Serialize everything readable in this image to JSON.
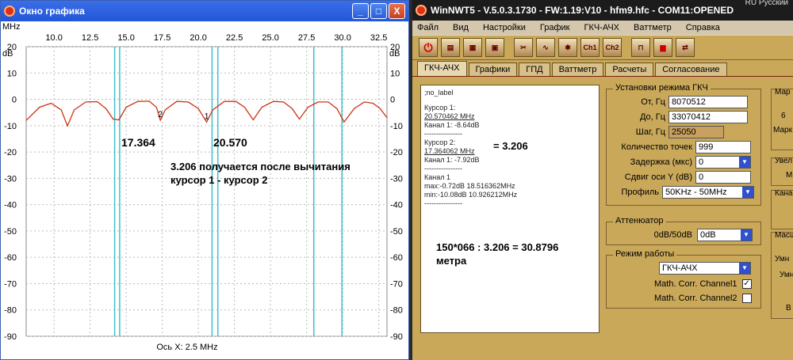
{
  "graph_window": {
    "title": "Окно графика",
    "buttons": {
      "minimize": "_",
      "maximize": "□",
      "close": "X"
    },
    "axis": {
      "mhz_label": "MHz",
      "db_label": "dB",
      "x_ticks": [
        "10.0",
        "12.5",
        "15.0",
        "17.5",
        "20.0",
        "22.5",
        "25.0",
        "27.5",
        "30.0",
        "32.5"
      ],
      "y_ticks": [
        "20",
        "10",
        "0",
        "-10",
        "-20",
        "-30",
        "-40",
        "-50",
        "-60",
        "-70",
        "-80",
        "-90"
      ],
      "x_caption": "Ось X: 2.5 MHz"
    },
    "markers": {
      "cursor1": "1",
      "cursor2": "2"
    },
    "annotations": {
      "cursor2_value": "17.364",
      "cursor1_value": "20.570",
      "note_line1": "3.206 получается после вычитания",
      "note_line2": "курсор 1 - курсор 2"
    },
    "trace_color": "#d03010"
  },
  "chart_data": {
    "type": "line",
    "title": "",
    "xlabel": "Ось X: 2.5 MHz",
    "ylabel": "dB",
    "xlim": [
      8.07,
      33.07
    ],
    "ylim": [
      -90,
      20
    ],
    "x_ticks": [
      10.0,
      12.5,
      15.0,
      17.5,
      20.0,
      22.5,
      25.0,
      27.5,
      30.0,
      32.5
    ],
    "y_ticks": [
      20,
      10,
      0,
      -10,
      -20,
      -30,
      -40,
      -50,
      -60,
      -70,
      -80,
      -90
    ],
    "grid": true,
    "series": [
      {
        "name": "Канал 1",
        "color": "#d03010",
        "x": [
          8.07,
          9.0,
          9.8,
          10.5,
          10.93,
          11.4,
          12.2,
          13.0,
          13.6,
          14.1,
          14.5,
          15.0,
          15.8,
          16.6,
          17.1,
          17.364,
          17.7,
          18.5,
          19.3,
          20.0,
          20.57,
          21.0,
          21.8,
          22.6,
          23.2,
          23.8,
          24.4,
          25.2,
          25.9,
          26.5,
          27.0,
          27.6,
          28.3,
          29.0,
          29.6,
          30.1,
          30.8,
          31.5,
          32.1,
          32.6,
          33.07
        ],
        "y": [
          -8,
          -3,
          -1.5,
          -4,
          -10.1,
          -4,
          -1,
          -0.9,
          -3.5,
          -7.5,
          -7.8,
          -3,
          -0.8,
          -0.72,
          -3,
          -7.92,
          -4,
          -0.8,
          -1,
          -3.5,
          -8.64,
          -4,
          -0.8,
          -0.8,
          -3,
          -7.8,
          -3,
          -0.8,
          -1,
          -3.5,
          -7.5,
          -3,
          -1,
          -1,
          -3.5,
          -8.6,
          -3.5,
          -1,
          -1.5,
          -3.5,
          -7
        ]
      }
    ],
    "cursors": [
      {
        "label": "1",
        "x": 20.570462,
        "y": -8.64
      },
      {
        "label": "2",
        "x": 17.364062,
        "y": -7.92
      }
    ],
    "vertical_markers_x": [
      14.2,
      14.55,
      20.95,
      21.35,
      28.0,
      29.95
    ]
  },
  "nwt_window": {
    "title": "WinNWT5 - V.5.0.3.1730 - FW:1.19:V10 - hfm9.hfc - COM11:OPENED",
    "status": "RU Русский",
    "menu": [
      "Файл",
      "Вид",
      "Настройки",
      "График",
      "ГКЧ-АЧХ",
      "Ваттметр",
      "Справка"
    ],
    "toolbar": [
      "power-icon",
      "print-icon",
      "bmp-icon",
      "image-icon",
      "tools-icon",
      "sweep-icon",
      "cal-icon",
      "ch1-icon",
      "ch2-icon",
      "step-icon",
      "save-icon",
      "swap-icon"
    ],
    "toolbar_labels": {
      "ch1": "Ch1",
      "ch2": "Ch2"
    },
    "tabs": [
      "ГКЧ-АЧХ",
      "Графики",
      "ГПД",
      "Ваттметр",
      "Расчеты",
      "Согласование"
    ],
    "memo": {
      "label": ";no_label",
      "cursor1_title": "Курсор 1:",
      "cursor1_freq": "20.570462 MHz",
      "cursor1_channel": "Канал 1: -8.64dB",
      "cursor2_title": "Курсор 2:",
      "cursor2_freq": "17.364062 MHz",
      "cursor2_channel": "Канал 1: -7.92dB",
      "channel_title": "Канал 1",
      "max": "max:-0.72dB 18.516362MHz",
      "min": "min:-10.08dB 10.926212MHz",
      "separator": "----------------"
    },
    "annotations": {
      "diff": "= 3.206",
      "calc_line1": "150*066 : 3.206 = 30.8796",
      "calc_line2": "метра"
    },
    "settings": {
      "title": "Установки режима ГКЧ",
      "from_label": "От, Гц",
      "from_value": "8070512",
      "to_label": "До, Гц",
      "to_value": "33070412",
      "step_label": "Шаг, Гц",
      "step_value": "25050",
      "points_label": "Количество точек",
      "points_value": "999",
      "delay_label": "Задержка (мкс)",
      "delay_value": "0",
      "yshift_label": "Сдвиг оси Y (dB)",
      "yshift_value": "0",
      "profile_label": "Профиль",
      "profile_value": "50KHz - 50MHz"
    },
    "attenuator": {
      "title": "Аттенюатор",
      "label": "0dB/50dB",
      "value": "0dB"
    },
    "mode": {
      "title": "Режим работы",
      "value": "ГКЧ-АЧХ",
      "math1_label": "Math. Corr. Channel1",
      "math1_checked": "✓",
      "math2_label": "Math. Corr. Channel2"
    },
    "right_stubs": {
      "s1": "Мар",
      "s2": "6",
      "s3": "Марк",
      "s4": "Увел",
      "s5": "М",
      "s6": "Кана",
      "s7": "Масш",
      "s8": "Умн",
      "s9": "Умн",
      "s10": "В"
    }
  }
}
